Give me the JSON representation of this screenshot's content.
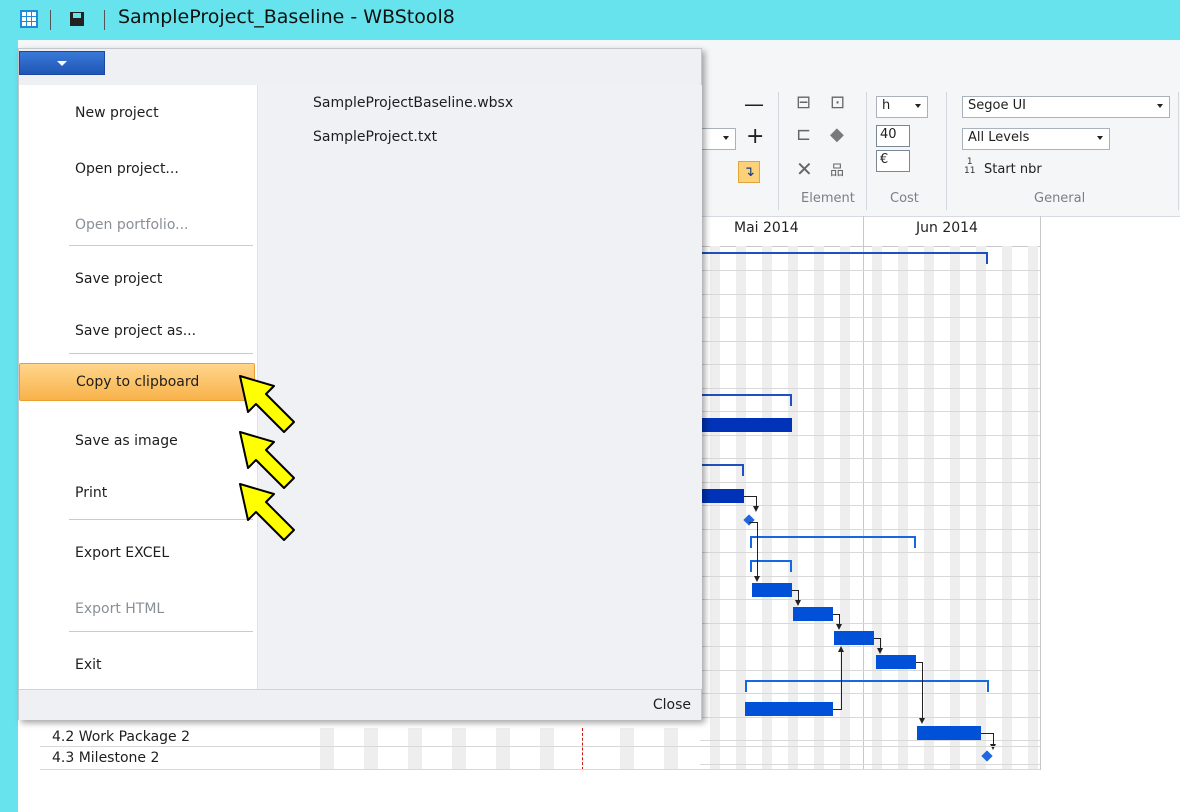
{
  "window": {
    "title": "SampleProject_Baseline - WBStool8"
  },
  "ribbon": {
    "minus": "—",
    "plus": "+",
    "unit_select": "h",
    "hours_value": "40",
    "currency_value": "€",
    "font_select": "Segoe UI",
    "levels_select": "All Levels",
    "start_nbr_label": "Start nbr",
    "groups": {
      "element": "Element",
      "cost": "Cost",
      "general": "General"
    }
  },
  "gantt": {
    "months": [
      "Mai 2014",
      "Jun 2014"
    ],
    "tasks": [
      "4.2 Work Package 2",
      "4.3 Milestone 2"
    ]
  },
  "file_menu": {
    "items": [
      {
        "label": "New project",
        "enabled": true
      },
      {
        "label": "Open project...",
        "enabled": true
      },
      {
        "label": "Open portfolio...",
        "enabled": false
      },
      {
        "label": "Save project",
        "enabled": true
      },
      {
        "label": "Save project as...",
        "enabled": true
      },
      {
        "label": "Copy to clipboard",
        "enabled": true,
        "highlighted": true
      },
      {
        "label": "Save as image",
        "enabled": true
      },
      {
        "label": "Print",
        "enabled": true
      },
      {
        "label": "Export EXCEL",
        "enabled": true
      },
      {
        "label": "Export HTML",
        "enabled": false
      },
      {
        "label": "Exit",
        "enabled": true
      }
    ],
    "recent_files": [
      "SampleProjectBaseline.wbsx",
      "SampleProject.txt"
    ],
    "close_label": "Close"
  },
  "colors": {
    "title_bar": "#66e3ec",
    "highlight": "#f8b24a",
    "gantt_bar": "#0050d8",
    "pointer": "#ffff00"
  }
}
